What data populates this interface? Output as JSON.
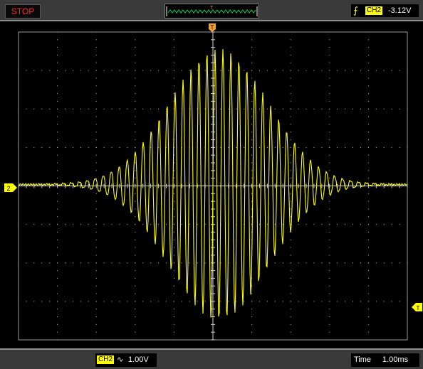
{
  "status": {
    "run_state": "STOP"
  },
  "trigger": {
    "edge_icon": "rising-edge-icon",
    "source": "CH2",
    "level": "-3.12V",
    "marker_label": "T"
  },
  "channel": {
    "name": "CH2",
    "marker_label": "2",
    "coupling_icon": "ac-coupling-icon",
    "coupling_symbol": "∿",
    "volts_per_div": "1.00V"
  },
  "timebase": {
    "label": "Time",
    "value": "1.00ms"
  },
  "colors": {
    "trace": "#ffff00",
    "grid": "#c8c8c8",
    "frame": "#8c8c8c",
    "bar": "#3a3a3a",
    "stop_text": "#ff2a2a",
    "orange_marker": "#f0a030"
  }
}
